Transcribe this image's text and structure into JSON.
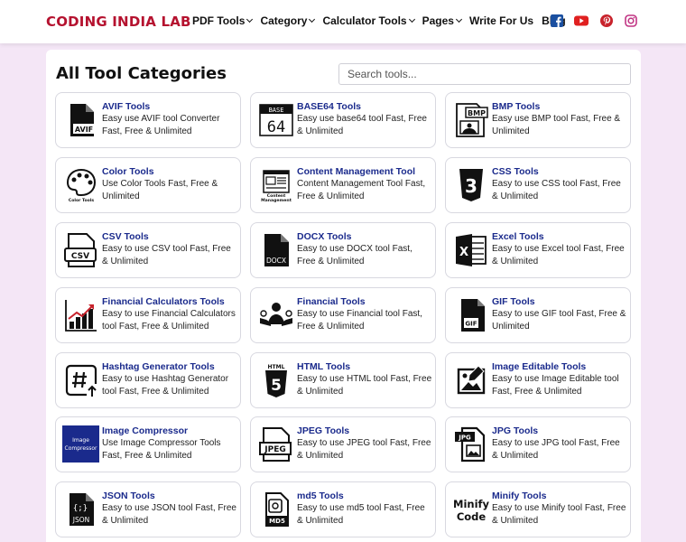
{
  "header": {
    "logo": "CODING INDIA LAB",
    "nav": [
      {
        "label": "PDF Tools",
        "dropdown": true
      },
      {
        "label": "Category",
        "dropdown": true
      },
      {
        "label": "Calculator Tools",
        "dropdown": true
      },
      {
        "label": "Pages",
        "dropdown": true
      },
      {
        "label": "Write For Us",
        "dropdown": false
      },
      {
        "label": "Blog",
        "dropdown": false
      }
    ],
    "social": [
      "facebook-icon",
      "youtube-icon",
      "pinterest-icon",
      "instagram-icon"
    ]
  },
  "main": {
    "title": "All Tool Categories",
    "search_placeholder": "Search tools..."
  },
  "cards": [
    {
      "title": "AVIF Tools",
      "desc": "Easy use AVIF tool Converter Fast, Free & Unlimited",
      "icon": "avif-file-icon"
    },
    {
      "title": "BASE64 Tools",
      "desc": "Easy use base64 tool Fast, Free & Unlimited",
      "icon": "base64-icon"
    },
    {
      "title": "BMP Tools",
      "desc": "Easy use BMP tool Fast, Free & Unlimited",
      "icon": "bmp-file-icon"
    },
    {
      "title": "Color Tools",
      "desc": "Use Color Tools Fast, Free & Unlimited",
      "icon": "color-palette-icon"
    },
    {
      "title": "Content Management Tool",
      "desc": "Content Management Tool Fast, Free & Unlimited",
      "icon": "content-management-icon"
    },
    {
      "title": "CSS Tools",
      "desc": "Easy to use CSS tool Fast, Free & Unlimited",
      "icon": "css3-icon"
    },
    {
      "title": "CSV Tools",
      "desc": "Easy to use CSV tool Fast, Free & Unlimited",
      "icon": "csv-file-icon"
    },
    {
      "title": "DOCX Tools",
      "desc": "Easy to use DOCX tool Fast, Free & Unlimited",
      "icon": "docx-file-icon"
    },
    {
      "title": "Excel Tools",
      "desc": "Easy to use Excel tool Fast, Free & Unlimited",
      "icon": "excel-icon"
    },
    {
      "title": "Financial Calculators Tools",
      "desc": "Easy to use Financial Calculators tool Fast, Free & Unlimited",
      "icon": "growth-chart-icon"
    },
    {
      "title": "Financial Tools",
      "desc": "Easy to use Financial tool Fast, Free & Unlimited",
      "icon": "finance-hand-icon"
    },
    {
      "title": "GIF Tools",
      "desc": "Easy to use GIF tool Fast, Free & Unlimited",
      "icon": "gif-file-icon"
    },
    {
      "title": "Hashtag Generator Tools",
      "desc": "Easy to use Hashtag Generator tool Fast, Free & Unlimited",
      "icon": "hashtag-icon"
    },
    {
      "title": "HTML Tools",
      "desc": "Easy to use HTML tool Fast, Free & Unlimited",
      "icon": "html5-icon"
    },
    {
      "title": "Image Editable Tools",
      "desc": "Easy to use Image Editable tool Fast, Free & Unlimited",
      "icon": "image-edit-icon"
    },
    {
      "title": "Image Compressor",
      "desc": "Use Image Compressor Tools Fast, Free & Unlimited",
      "icon": "image-compressor-icon"
    },
    {
      "title": "JPEG Tools",
      "desc": "Easy to use JPEG tool Fast, Free & Unlimited",
      "icon": "jpeg-file-icon"
    },
    {
      "title": "JPG Tools",
      "desc": "Easy to use JPG tool Fast, Free & Unlimited",
      "icon": "jpg-file-icon"
    },
    {
      "title": "JSON Tools",
      "desc": "Easy to use JSON tool Fast, Free & Unlimited",
      "icon": "json-file-icon"
    },
    {
      "title": "md5 Tools",
      "desc": "Easy to use md5 tool Fast, Free & Unlimited",
      "icon": "md5-file-icon"
    },
    {
      "title": "Minify Tools",
      "desc": "Easy to use Minify tool Fast, Free & Unlimited",
      "icon": "minify-code-icon"
    }
  ],
  "icon_text": {
    "avif": "AVIF",
    "base64_top": "BASE",
    "base64_big": "64",
    "bmp": "BMP",
    "color_caption": "Color Tools",
    "content_caption_1": "Content",
    "content_caption_2": "Management",
    "csv": "CSV",
    "docx": "DOCX",
    "excel": "X",
    "gif": "GIF",
    "html_caption": "HTML",
    "html_big": "5",
    "css_big": "3",
    "compressor_1": "Image",
    "compressor_2": "Compressor",
    "jpeg": "JPEG",
    "jpg": "JPG",
    "json_braces": "{;}",
    "json": "JSON",
    "md5": "MD5",
    "minify_1": "Minify",
    "minify_2": "Code"
  },
  "colors": {
    "brand": "#b5122f",
    "card_title": "#1a2a8c",
    "background": "#f4e6f6",
    "facebook": "#1a4fa0",
    "youtube": "#e02020",
    "pinterest": "#c8232c",
    "instagram": "#c13584"
  }
}
